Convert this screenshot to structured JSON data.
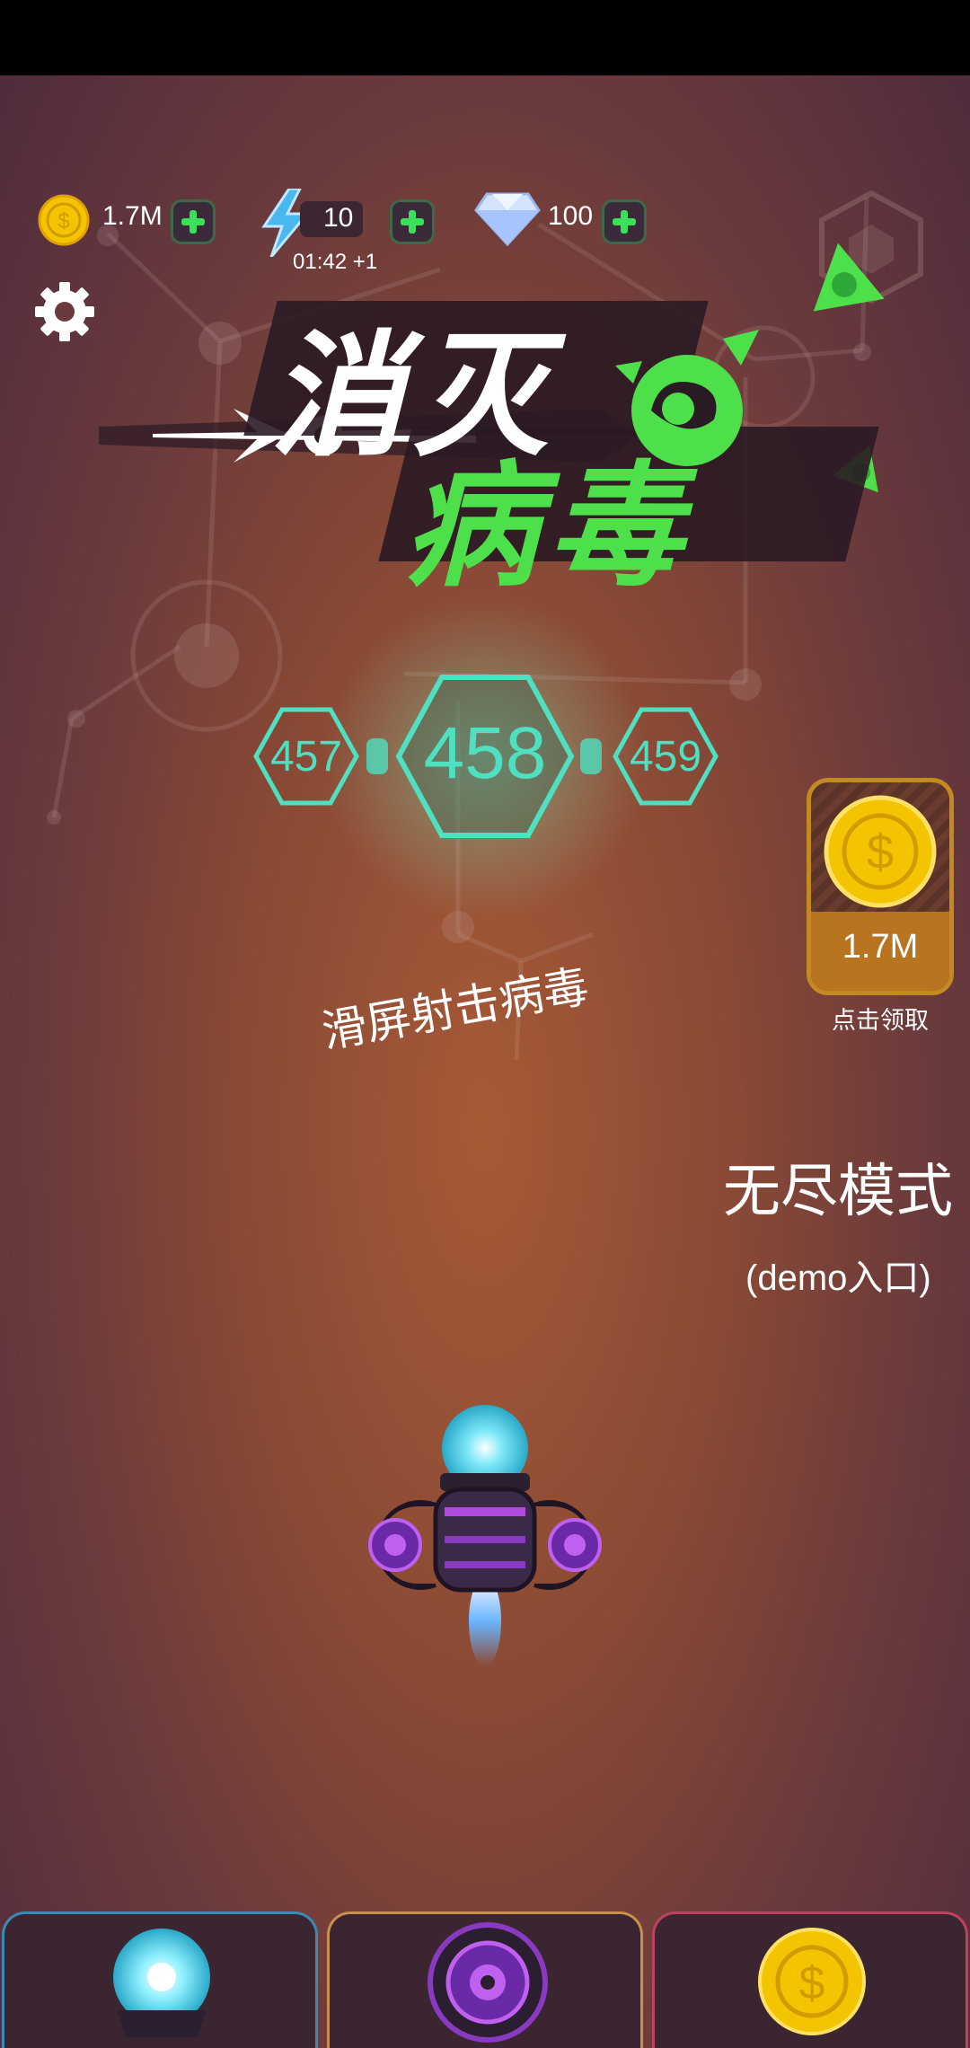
{
  "resources": {
    "coins": "1.7M",
    "energy": "10",
    "energy_timer": "01:42 +1",
    "gems": "100"
  },
  "title": {
    "line1": "消灭",
    "line2": "病毒"
  },
  "levels": {
    "prev": "457",
    "current": "458",
    "next": "459"
  },
  "coin_reward": {
    "amount": "1.7M",
    "label": "点击领取"
  },
  "hint": "滑屏射击病毒",
  "endless": {
    "title": "无尽模式",
    "subtitle": "(demo入口)"
  },
  "tabs": [
    {
      "name": "ship",
      "color": "#3a8ab8"
    },
    {
      "name": "weapon",
      "color": "#c8904a"
    },
    {
      "name": "shop",
      "color": "#c04060"
    }
  ],
  "colors": {
    "virus_green": "#4ee04a",
    "level_teal": "#4ee0c0",
    "coin_gold": "#f5c400"
  }
}
